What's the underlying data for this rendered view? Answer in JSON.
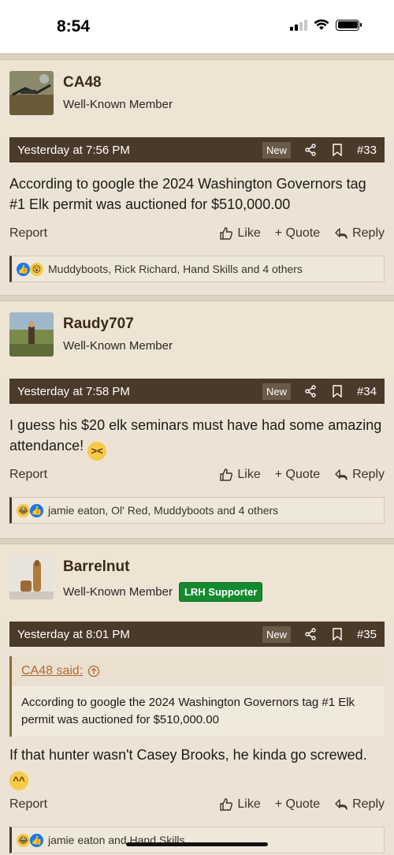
{
  "status": {
    "time": "8:54"
  },
  "posts": [
    {
      "username": "CA48",
      "user_title": "Well-Known Member",
      "badge": "",
      "date": "Yesterday at 7:56 PM",
      "new_label": "New",
      "post_number": "#33",
      "content": "According to google the 2024 Washington Governors tag #1 Elk permit was auctioned for $510,000.00",
      "reactions_text": "Muddyboots, Rick Richard, Hand Skills and 4 others"
    },
    {
      "username": "Raudy707",
      "user_title": "Well-Known Member",
      "badge": "",
      "date": "Yesterday at 7:58 PM",
      "new_label": "New",
      "post_number": "#34",
      "content": "I guess his $20 elk seminars must have had some amazing attendance!",
      "reactions_text": "jamie eaton, Ol' Red, Muddyboots and 4 others"
    },
    {
      "username": "Barrelnut",
      "user_title": "Well-Known Member",
      "badge": "LRH Supporter",
      "date": "Yesterday at 8:01 PM",
      "new_label": "New",
      "post_number": "#35",
      "quote_author": "CA48 said:",
      "quote_text": "According to google the 2024 Washington Governors tag #1 Elk permit was auctioned for $510,000.00",
      "content": "If that hunter wasn't Casey Brooks, he kinda go screwed.",
      "reactions_text": "jamie eaton and Hand Skills"
    }
  ],
  "actions": {
    "report": "Report",
    "like": "Like",
    "quote": "+ Quote",
    "reply": "Reply"
  }
}
